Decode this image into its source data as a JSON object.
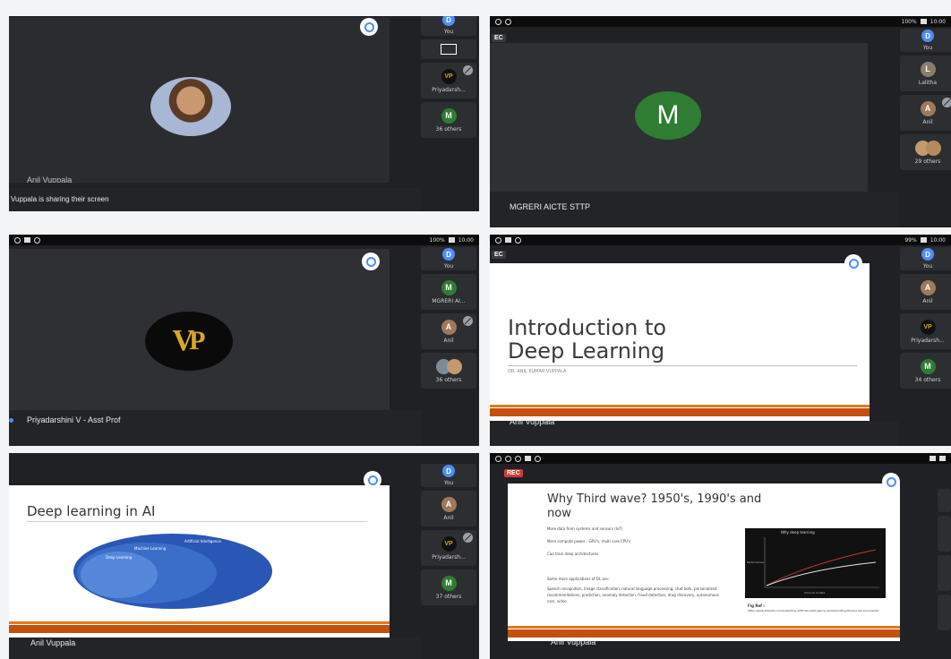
{
  "colors": {
    "you_avatar": "#4d8ef7",
    "meet_green": "#2e7d32",
    "slide_bar": "#c4500e",
    "rec_red": "#d23b3b",
    "venn_blue": "#2a57b5"
  },
  "status": {
    "time": "10:00",
    "battery": "100%",
    "battery_alt": "99%"
  },
  "panel1": {
    "main_speaker": "Anil Vuppala",
    "sharing_note": "Vuppala is sharing their screen",
    "rail": [
      {
        "avatar": "D",
        "label": "You"
      },
      {
        "avatar": "VP",
        "label": "Priyadarsh..."
      },
      {
        "avatar": "M",
        "label": "36 others"
      }
    ]
  },
  "panel2": {
    "rec": "EC",
    "avatar_letter": "M",
    "speaker": "MGRERI AICTE STTP",
    "rail": [
      {
        "avatar": "D",
        "label": "You"
      },
      {
        "avatar": "L",
        "label": "Lalitha"
      },
      {
        "avatar": "A",
        "label": "Anil"
      },
      {
        "avatar": "",
        "label": "29 others"
      }
    ]
  },
  "panel3": {
    "rec": "EC",
    "speaker": "Priyadarshini V - Asst Prof",
    "rail": [
      {
        "avatar": "D",
        "label": "You"
      },
      {
        "avatar": "M",
        "label": "MGRERI AI..."
      },
      {
        "avatar": "A",
        "label": "Anil"
      },
      {
        "avatar": "",
        "label": "36 others"
      }
    ]
  },
  "panel4": {
    "rec": "EC",
    "slide_title_1": "Introduction to",
    "slide_title_2": "Deep Learning",
    "slide_author": "DR. ANIL KUMAR VUPPALA",
    "speaker": "Anil Vuppala",
    "rail": [
      {
        "avatar": "D",
        "label": "You"
      },
      {
        "avatar": "A",
        "label": "Anil"
      },
      {
        "avatar": "VP",
        "label": "Priyadarsh..."
      },
      {
        "avatar": "M",
        "label": "34 others"
      }
    ]
  },
  "panel5": {
    "slide_title": "Deep learning in AI",
    "venn": {
      "outer": "Artificial Intelligence",
      "middle": "Machine Learning",
      "inner": "Deep Learning"
    },
    "speaker": "Anil Vuppala",
    "rail": [
      {
        "avatar": "D",
        "label": "You"
      },
      {
        "avatar": "A",
        "label": "Anil"
      },
      {
        "avatar": "VP",
        "label": "Priyadarsh..."
      },
      {
        "avatar": "M",
        "label": "37 others"
      }
    ]
  },
  "panel6": {
    "rec": "REC",
    "slide_title_1": "Why Third wave? 1950's, 1990's and",
    "slide_title_2": "now",
    "bullets": [
      "More data from systems and sensors (IoT)",
      "More compute power - GPU's, multi core CPU's",
      "Cao train deep architectures"
    ],
    "apps_heading": "Some more applications of DL are:",
    "apps_text": "Speech recognition, Image classification, natural language processing, chat bots, personalized recommendations, prediction, anomaly detection, fraud detection, drug discovery, autonomous cars, video",
    "chart_title": "Why deep learning",
    "chart_x": "Amount of data",
    "chart_y": "Performance",
    "fig_ref": "Fig Ref :",
    "fig_url": "https://www.linkedin.com/pulse/how-artificial-intelli gence-revolutionizing-finance-del-lone-bankar",
    "speaker": "Anil Vuppala"
  }
}
